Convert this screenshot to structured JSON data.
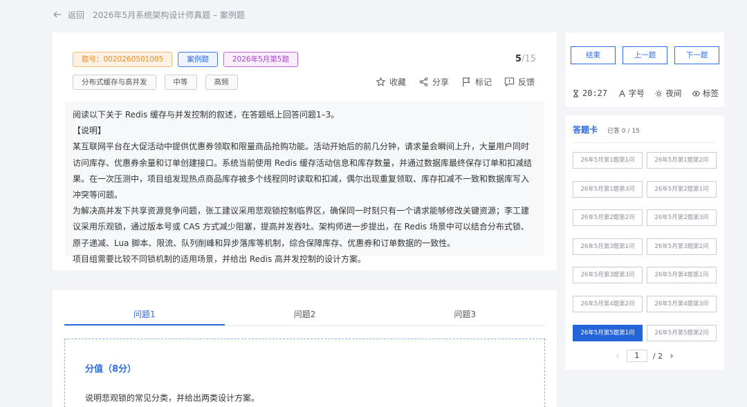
{
  "header": {
    "back_label": "返回",
    "title": "2026年5月系统架构设计师真题 – 案例题"
  },
  "question": {
    "tags": {
      "id_tag": "题号：0020260501005",
      "type_tag": "案例题",
      "source_tag": "2026年5月第5题"
    },
    "counter": {
      "current": "5",
      "total": "/15"
    },
    "attributes": [
      "分布式缓存与高并发",
      "中等",
      "高频"
    ],
    "actions": {
      "favorite": "收藏",
      "share": "分享",
      "mark": "标记",
      "feedback": "反馈"
    },
    "material": [
      "阅读以下关于 Redis 缓存与并发控制的叙述，在答题纸上回答问题1–3。",
      "【说明】",
      "某互联网平台在大促活动中提供优惠券领取和限量商品抢购功能。活动开始后的前几分钟，请求量会瞬间上升，大量用户同时访问库存、优惠券余量和订单创建接口。系统当前使用 Redis 缓存活动信息和库存数量，并通过数据库最终保存订单和扣减结果。在一次压测中，项目组发现热点商品库存被多个线程同时读取和扣减，偶尔出现重复领取、库存扣减不一致和数据库写入冲突等问题。",
      "为解决高并发下共享资源竞争问题，张工建议采用悲观锁控制临界区，确保同一时刻只有一个请求能够修改关键资源；李工建议采用乐观锁，通过版本号或 CAS 方式减少阻塞，提高并发吞吐。架构师进一步提出，在 Redis 场景中可以结合分布式锁、原子递减、Lua 脚本、限流、队列削峰和异步落库等机制，综合保障库存、优惠券和订单数据的一致性。",
      "项目组需要比较不同锁机制的适用场景，并给出 Redis 高并发控制的设计方案。"
    ]
  },
  "sub_questions": {
    "tabs": [
      "问题1",
      "问题2",
      "问题3"
    ],
    "active_tab": 0,
    "score": "分值（8分）",
    "text": "说明悲观锁的常见分类，并给出两类设计方案。"
  },
  "controls": {
    "end": "结束",
    "prev": "上一题",
    "next": "下一题",
    "timer": "20:27",
    "font_size": "字号",
    "night": "夜间",
    "bookmark": "标签"
  },
  "answer_sheet": {
    "title": "答题卡",
    "done": "已答 0 / 15",
    "items": [
      "26年5月第1题第1问",
      "26年5月第1题第2问",
      "26年5月第1题第3问",
      "26年5月第2题第1问",
      "26年5月第2题第2问",
      "26年5月第2题第3问",
      "26年5月第3题第1问",
      "26年5月第3题第2问",
      "26年5月第3题第3问",
      "26年5月第4题第1问",
      "26年5月第4题第2问",
      "26年5月第4题第3问",
      "26年5月第5题第1问",
      "26年5月第5题第2问"
    ],
    "active_index": 12,
    "pager": {
      "current": "1",
      "total": "/ 2"
    }
  },
  "colors": {
    "accent": "#2d6ce0",
    "orange": "#ed8a19",
    "purple": "#b13fd0"
  }
}
